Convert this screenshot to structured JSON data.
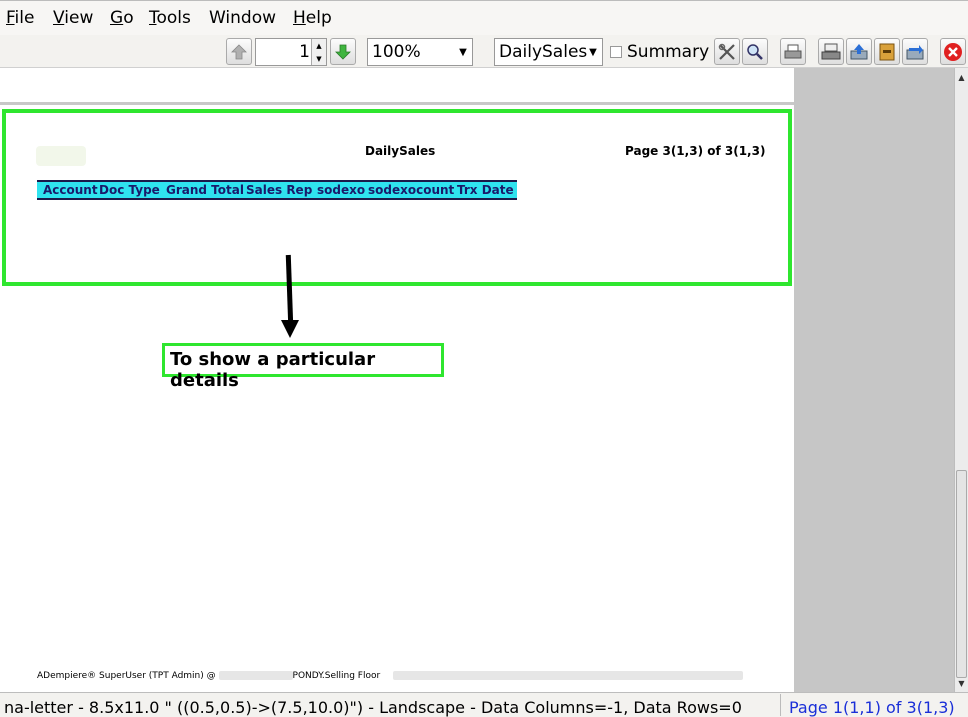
{
  "menubar": {
    "items": [
      {
        "label": "File",
        "mnemonic": "F",
        "rest": "ile"
      },
      {
        "label": "View",
        "mnemonic": "V",
        "rest": "iew"
      },
      {
        "label": "Go",
        "mnemonic": "G",
        "rest": "o"
      },
      {
        "label": "Tools",
        "mnemonic": "T",
        "rest": "ools"
      },
      {
        "label": "Window",
        "mnemonic": "",
        "rest": "Window"
      },
      {
        "label": "Help",
        "mnemonic": "H",
        "rest": "elp"
      }
    ]
  },
  "toolbar": {
    "page_value": "1",
    "zoom_value": "100%",
    "report_value": "DailySales",
    "summary_label": "Summary",
    "icons": [
      "arrow-up-icon",
      "arrow-down-icon",
      "customize-icon",
      "find-icon",
      "print-icon",
      "scanner-icon",
      "upload-icon",
      "archive-icon",
      "export-icon",
      "close-icon"
    ],
    "colors": {
      "prev": "#b0b0b0",
      "next": "#3fb53f",
      "close": "#e02020"
    }
  },
  "report": {
    "title": "DailySales",
    "page_indicator": "Page 3(1,3) of 3(1,3)",
    "columns": [
      "Account",
      "Doc Type",
      "Grand Total",
      "Sales Rep",
      "sodexo",
      "sodexocount",
      "Trx Date"
    ],
    "footer_left": "ADempiere® SuperUser (TPT Admin) @",
    "footer_org": "PONDY.Selling Floor"
  },
  "annotation": {
    "callout": "To show a particular details",
    "highlight_color": "#2fe62f"
  },
  "statusbar": {
    "info": "na-letter - 8.5x11.0 \" ((0.5,0.5)->(7.5,10.0)\") - Landscape - Data Columns=-1, Data Rows=0",
    "page": "Page 1(1,1) of 3(1,3)"
  }
}
